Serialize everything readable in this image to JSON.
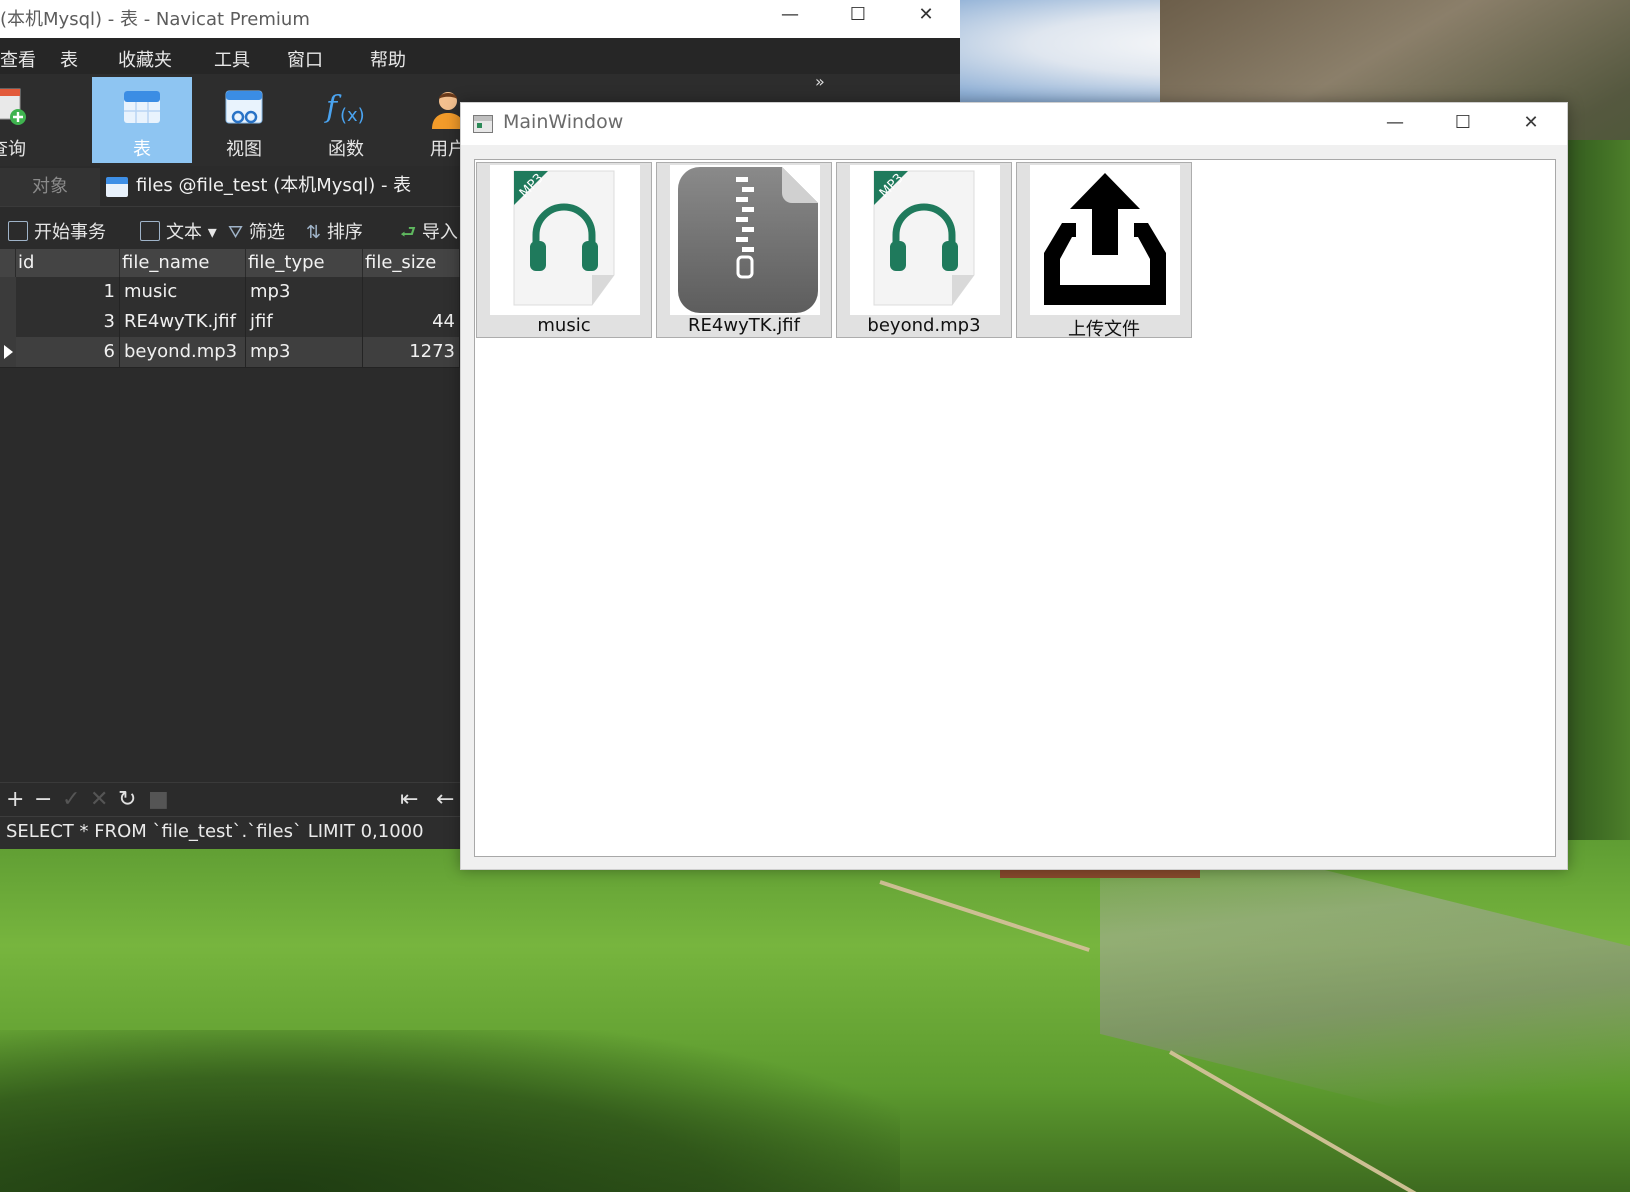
{
  "navicat": {
    "window_title": "(本机Mysql) - 表 - Navicat Premium",
    "menu": [
      "查看",
      "表",
      "收藏夹",
      "工具",
      "窗口",
      "帮助"
    ],
    "toolbar": [
      {
        "label": "查询",
        "icon": "query-icon"
      },
      {
        "label": "表",
        "icon": "table-icon",
        "active": true
      },
      {
        "label": "视图",
        "icon": "view-icon"
      },
      {
        "label": "函数",
        "icon": "function-icon"
      },
      {
        "label": "用户",
        "icon": "user-icon"
      }
    ],
    "toolbar_more": "»",
    "tabs": {
      "objects": "对象",
      "current": "files @file_test (本机Mysql) - 表"
    },
    "subtoolbar": {
      "begin_transaction": "开始事务",
      "text": "文本",
      "filter": "筛选",
      "sort": "排序",
      "import": "导入"
    },
    "grid": {
      "columns": [
        "id",
        "file_name",
        "file_type",
        "file_size"
      ],
      "rows": [
        {
          "id": "1",
          "file_name": "music",
          "file_type": "mp3",
          "file_size": ""
        },
        {
          "id": "3",
          "file_name": "RE4wyTK.jfif",
          "file_type": "jfif",
          "file_size": "44"
        },
        {
          "id": "6",
          "file_name": "beyond.mp3",
          "file_type": "mp3",
          "file_size": "1273"
        }
      ]
    },
    "bottom_buttons": {
      "add": "+",
      "remove": "−",
      "apply": "✓",
      "discard": "✕",
      "refresh": "↻",
      "stop": "■",
      "first": "⇤",
      "prev": "←"
    },
    "sql": "SELECT * FROM `file_test`.`files` LIMIT 0,1000"
  },
  "mainwindow": {
    "title": "MainWindow",
    "files": [
      {
        "name": "music",
        "icon": "mp3-headphones-icon"
      },
      {
        "name": "RE4wyTK.jfif",
        "icon": "zip-file-icon"
      },
      {
        "name": "beyond.mp3",
        "icon": "mp3-headphones-icon"
      },
      {
        "name": "上传文件",
        "icon": "upload-icon"
      }
    ],
    "mp3_badge": "MP3"
  },
  "window_controls": {
    "minimize": "—",
    "maximize": "☐",
    "close": "✕"
  },
  "colors": {
    "navicat_bg": "#2b2b2b",
    "active_tool": "#8ec5f2",
    "mp3_green": "#1f7a5c"
  }
}
